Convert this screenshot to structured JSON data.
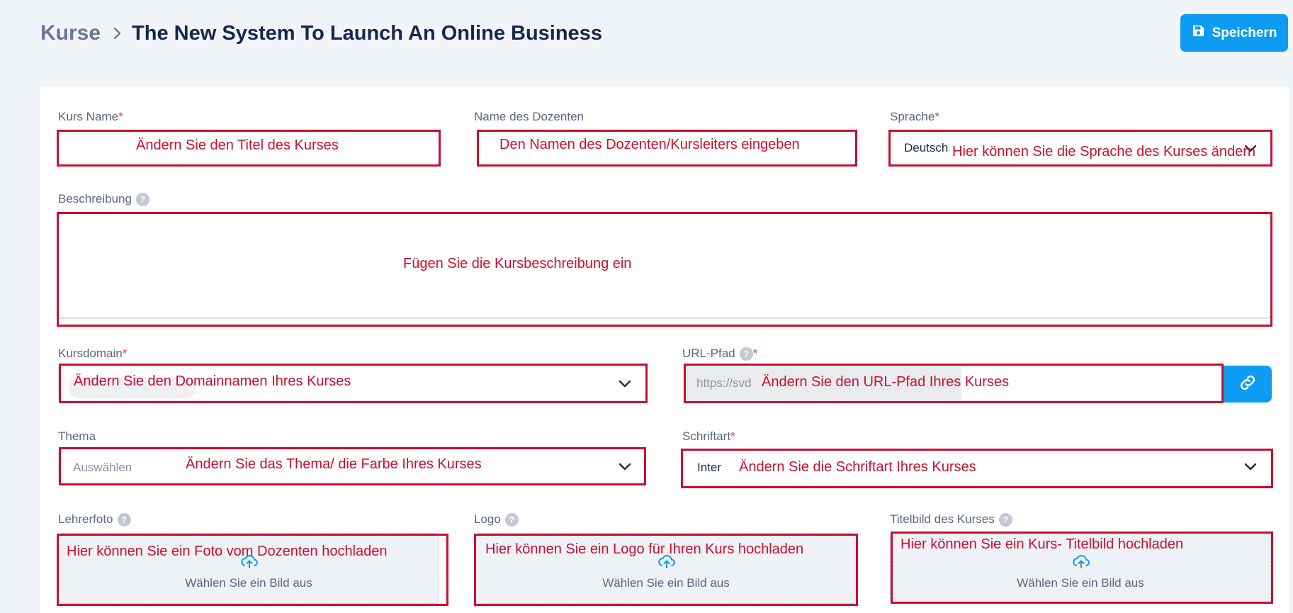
{
  "breadcrumb": {
    "root": "Kurse",
    "title": "The New System To Launch An Online Business"
  },
  "toolbar": {
    "save_label": "Speichern"
  },
  "form": {
    "course_name": {
      "label": "Kurs Name",
      "required_mark": "*",
      "annotation": "Ändern Sie den Titel des Kurses"
    },
    "instructor": {
      "label": "Name des Dozenten",
      "annotation": "Den Namen des Dozenten/Kursleiters eingeben"
    },
    "language": {
      "label": "Sprache",
      "required_mark": "*",
      "value": "Deutsch",
      "annotation": "Hier können Sie die Sprache des Kurses ändern"
    },
    "description": {
      "label": "Beschreibung",
      "help": "?",
      "annotation": "Fügen Sie die Kursbeschreibung ein"
    },
    "domain": {
      "label": "Kursdomain",
      "required_mark": "*",
      "annotation": "Ändern Sie den Domainnamen Ihres Kurses"
    },
    "url_path": {
      "label": "URL-Pfad",
      "help": "?",
      "required_mark": "*",
      "prefix": "https://svd",
      "annotation": "Ändern Sie den URL-Pfad Ihres Kurses"
    },
    "theme": {
      "label": "Thema",
      "placeholder": "Auswählen",
      "annotation": "Ändern Sie das Thema/ die Farbe Ihres Kurses"
    },
    "font": {
      "label": "Schriftart",
      "required_mark": "*",
      "value": "Inter",
      "annotation": "Ändern Sie die Schriftart Ihres Kurses"
    },
    "teacher_photo": {
      "label": "Lehrerfoto",
      "help": "?",
      "upload_text": "Wählen Sie ein Bild aus",
      "annotation": "Hier können Sie ein Foto vom Dozenten hochladen"
    },
    "logo": {
      "label": "Logo",
      "help": "?",
      "upload_text": "Wählen Sie ein Bild aus",
      "annotation": "Hier können Sie ein Logo für Ihren Kurs hochladen"
    },
    "cover_image": {
      "label": "Titelbild des Kurses",
      "help": "?",
      "upload_text": "Wählen Sie ein Bild aus",
      "annotation": "Hier können Sie ein Kurs- Titelbild hochladen"
    }
  },
  "colors": {
    "accent": "#0d9cf2",
    "annotation_red": "#c8102e",
    "required": "#e53946"
  },
  "icons": {
    "save": "save-icon",
    "breadcrumb": "chevron-right-icon",
    "select": "chevron-down-icon",
    "link": "link-icon",
    "upload": "cloud-upload-icon",
    "help": "help-icon"
  }
}
